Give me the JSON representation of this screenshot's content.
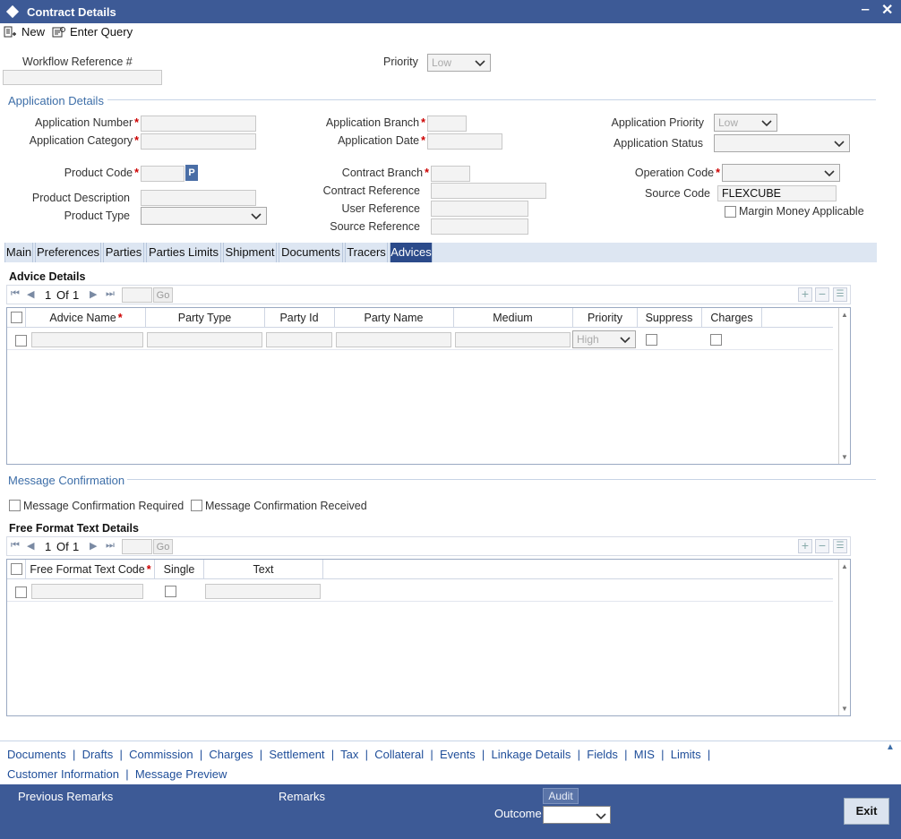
{
  "window": {
    "title": "Contract Details"
  },
  "toolbar": {
    "new_label": "New",
    "enter_query_label": "Enter Query"
  },
  "header": {
    "workflow_ref_label": "Workflow Reference #",
    "priority_label": "Priority",
    "priority_value": "Low"
  },
  "application": {
    "section_title": "Application Details",
    "app_number_label": "Application Number",
    "app_category_label": "Application Category",
    "app_branch_label": "Application Branch",
    "app_date_label": "Application Date",
    "app_priority_label": "Application Priority",
    "app_priority_value": "Low",
    "app_status_label": "Application Status",
    "product_code_label": "Product Code",
    "product_code_btn": "P",
    "product_desc_label": "Product Description",
    "product_type_label": "Product Type",
    "contract_branch_label": "Contract Branch",
    "contract_ref_label": "Contract Reference",
    "user_ref_label": "User Reference",
    "source_ref_label": "Source Reference",
    "operation_code_label": "Operation Code",
    "source_code_label": "Source Code",
    "source_code_value": "FLEXCUBE",
    "margin_money_label": "Margin Money Applicable"
  },
  "tabs": [
    "Main",
    "Preferences",
    "Parties",
    "Parties Limits",
    "Shipment",
    "Documents",
    "Tracers",
    "Advices"
  ],
  "advice": {
    "title": "Advice Details",
    "page_current": "1",
    "page_of": "Of",
    "page_total": "1",
    "go": "Go",
    "columns": [
      "Advice Name",
      "Party Type",
      "Party Id",
      "Party Name",
      "Medium",
      "Priority",
      "Suppress",
      "Charges"
    ],
    "row_priority": "High"
  },
  "message": {
    "section_title": "Message Confirmation",
    "required_label": "Message Confirmation Required",
    "received_label": "Message Confirmation Received"
  },
  "freeformat": {
    "title": "Free Format Text Details",
    "page_current": "1",
    "page_of": "Of",
    "page_total": "1",
    "go": "Go",
    "columns": [
      "Free Format Text Code",
      "Single",
      "Text"
    ]
  },
  "footer_links": {
    "row1": [
      "Documents",
      "Drafts",
      "Commission",
      "Charges",
      "Settlement",
      "Tax",
      "Collateral",
      "Events",
      "Linkage Details",
      "Fields",
      "MIS",
      "Limits"
    ],
    "row2": [
      "Customer Information",
      "Message Preview"
    ]
  },
  "bottom": {
    "previous_remarks": "Previous Remarks",
    "remarks": "Remarks",
    "audit": "Audit",
    "outcome": "Outcome",
    "exit": "Exit"
  },
  "colors": {
    "titlebar": "#3d5a96",
    "section": "#3d6ea8",
    "link": "#1f4e99",
    "active_tab": "#2b4a8a"
  }
}
